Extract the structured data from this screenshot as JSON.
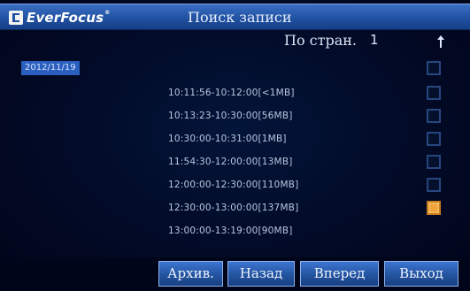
{
  "header": {
    "logo_text": "EverFocus",
    "logo_mark": "®",
    "title": "Поиск записи"
  },
  "page_selector": {
    "label": "По стран.",
    "value": "1",
    "arrow_icon": "scroll-arrow-icon"
  },
  "date": "2012/11/19",
  "records": [
    {
      "time": "10:11:56-10:12:00[<1MB]",
      "checked": false
    },
    {
      "time": "10:13:23-10:30:00[56MB]",
      "checked": false
    },
    {
      "time": "10:30:00-10:31:00[1MB]",
      "checked": false
    },
    {
      "time": "11:54:30-12:00:00[13MB]",
      "checked": false
    },
    {
      "time": "12:00:00-12:30:00[110MB]",
      "checked": false
    },
    {
      "time": "12:30:00-13:00:00[137MB]",
      "checked": true
    },
    {
      "time": "13:00:00-13:19:00[90MB]",
      "checked": false
    }
  ],
  "buttons": {
    "archive": "Архив.",
    "back": "Назад",
    "forward": "Вперед",
    "exit": "Выход"
  },
  "colors": {
    "header_blue": "#1f4f9f",
    "selected_orange": "#f0a43a",
    "date_highlight": "#2a5fbf"
  }
}
